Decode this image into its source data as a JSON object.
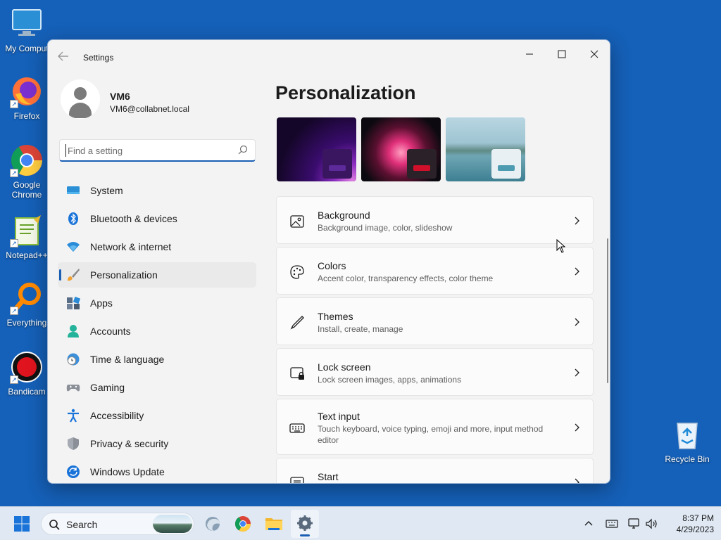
{
  "desktop": {
    "icons": [
      {
        "label": "My Comput"
      },
      {
        "label": "Firefox"
      },
      {
        "label": "Google Chrome"
      },
      {
        "label": "Notepad++"
      },
      {
        "label": "Everything"
      },
      {
        "label": "Bandicam"
      }
    ],
    "recycle_bin": {
      "label": "Recycle Bin"
    }
  },
  "window": {
    "title": "Settings",
    "controls": {
      "minimize": "—",
      "maximize": "▢",
      "close": "✕"
    }
  },
  "user": {
    "name": "VM6",
    "email": "VM6@collabnet.local"
  },
  "search": {
    "placeholder": "Find a setting",
    "value": ""
  },
  "nav": {
    "items": [
      {
        "label": "System",
        "icon": "system-icon"
      },
      {
        "label": "Bluetooth & devices",
        "icon": "bluetooth-icon"
      },
      {
        "label": "Network & internet",
        "icon": "wifi-icon"
      },
      {
        "label": "Personalization",
        "icon": "brush-icon",
        "active": true
      },
      {
        "label": "Apps",
        "icon": "apps-icon"
      },
      {
        "label": "Accounts",
        "icon": "accounts-icon"
      },
      {
        "label": "Time & language",
        "icon": "clock-globe-icon"
      },
      {
        "label": "Gaming",
        "icon": "gamepad-icon"
      },
      {
        "label": "Accessibility",
        "icon": "accessibility-icon"
      },
      {
        "label": "Privacy & security",
        "icon": "shield-icon"
      },
      {
        "label": "Windows Update",
        "icon": "update-icon"
      }
    ]
  },
  "main": {
    "title": "Personalization",
    "themes": [
      {
        "name": "theme-dark-bloom",
        "accent": "#4a1a7a"
      },
      {
        "name": "theme-glow",
        "accent": "#d0102a"
      },
      {
        "name": "theme-lake",
        "accent": "#4c9bb0"
      }
    ],
    "cards": [
      {
        "title": "Background",
        "desc": "Background image, color, slideshow",
        "icon": "image-icon"
      },
      {
        "title": "Colors",
        "desc": "Accent color, transparency effects, color theme",
        "icon": "palette-icon"
      },
      {
        "title": "Themes",
        "desc": "Install, create, manage",
        "icon": "pen-icon"
      },
      {
        "title": "Lock screen",
        "desc": "Lock screen images, apps, animations",
        "icon": "lock-screen-icon"
      },
      {
        "title": "Text input",
        "desc": "Touch keyboard, voice typing, emoji and more, input method editor",
        "icon": "keyboard-icon"
      },
      {
        "title": "Start",
        "desc": "",
        "icon": "start-icon"
      }
    ]
  },
  "taskbar": {
    "search_label": "Search",
    "time": "8:37 PM",
    "date": "4/29/2023",
    "accent": "#1a5fb4"
  }
}
